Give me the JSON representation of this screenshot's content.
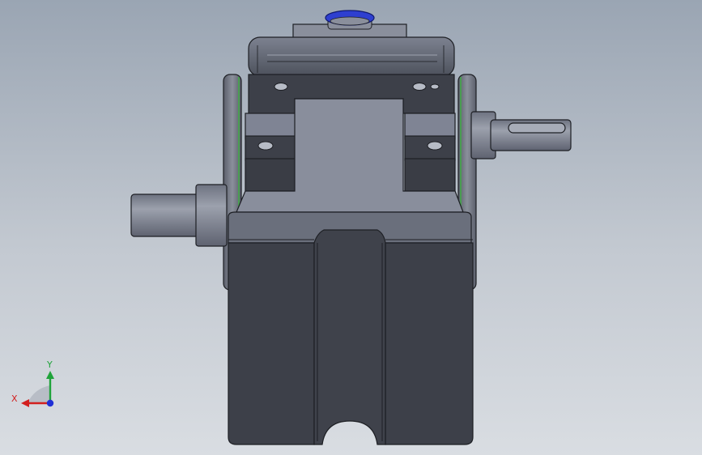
{
  "viewport": {
    "background_top": "#9aa5b3",
    "background_bottom": "#d9dde2",
    "model_colors": {
      "housing_dark": "#3d4049",
      "housing_mid": "#5c606c",
      "housing_light": "#7b8090",
      "shaft": "#8a8f9c",
      "bearing_ring": "#2e3fd0",
      "seal_ring": "#3fae45"
    }
  },
  "triad": {
    "x_label": "X",
    "y_label": "Y",
    "x_color": "#d21f1f",
    "y_color": "#1fa33a",
    "z_color": "#1f2fd6"
  }
}
